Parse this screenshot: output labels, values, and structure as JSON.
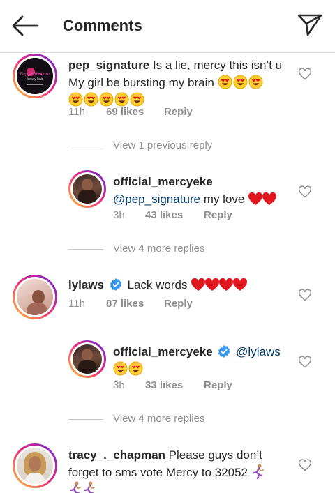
{
  "header": {
    "title": "Comments"
  },
  "colors": {
    "text": "#262626",
    "secondary": "#8e8e8e",
    "mention": "#00376b",
    "verified": "#3897f0",
    "emoji_heart": "#e0171f",
    "emoji_face": "#ffcc33"
  },
  "comments": [
    {
      "username": "pep_signature",
      "line1": "Is a lie, mercy this isn’t u",
      "line2": "My girl be bursting my brain",
      "time": "11h",
      "likes": "69 likes",
      "reply": "Reply",
      "avatar_text": "Pep Signature",
      "avatar_subtext": "luxury hair"
    },
    {
      "view_more": "View 1 previous reply"
    },
    {
      "username": "official_mercyeke",
      "mention": "@pep_signature",
      "text": "my love",
      "time": "3h",
      "likes": "43 likes",
      "reply": "Reply"
    },
    {
      "view_more": "View 4 more replies"
    },
    {
      "username": "lylaws",
      "text": "Lack words",
      "time": "11h",
      "likes": "87 likes",
      "reply": "Reply"
    },
    {
      "username": "official_mercyeke",
      "mention": "@lylaws",
      "time": "3h",
      "likes": "33 likes",
      "reply": "Reply"
    },
    {
      "view_more": "View 4 more replies"
    },
    {
      "username": "tracy_._chapman",
      "line1": "Please guys don’t",
      "line2": "forget to sms vote Mercy to 32052"
    }
  ]
}
